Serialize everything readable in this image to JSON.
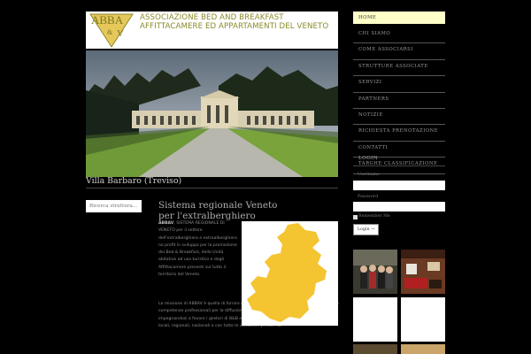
{
  "header": {
    "logo_text": "ABBA",
    "org_line1": "ASSOCIAZIONE BED AND BREAKFAST",
    "org_line2": "AFFITTACAMERE ED APPARTAMENTI DEL VENETO"
  },
  "hero": {
    "caption": "Villa Barbaro (Treviso)"
  },
  "search": {
    "placeholder": "Ricerca struttura..."
  },
  "article": {
    "title": "Sistema regionale Veneto per l'extralberghiero",
    "lead_bold": "ABBAV",
    "lead_rest": ", SISTEMA REGIONALE DI VENETO per il settore dell'extralberghiero e extraalberghiero no profit in sviluppo per la promozione dei Bed & Breakfast, delle Unità abitative ad uso turistico e degli Affittacamere presenti sul tutto il territorio del Veneto.",
    "para2": "La missione di ABBAV è quella di fornire consulenza e servizi di alta qualità, assistenza e competenze professionali per la diffusione dei servizi tipologie. ABBAV mette impegnandosi a favore i gestori di B&B e Affittacamere nei rapporti con gli enti pubblici locali, regionali, nazionali e con tutte le istituzioni private sul"
  },
  "nav": {
    "items": [
      {
        "label": "HOME",
        "active": true
      },
      {
        "label": "CHI SIAMO",
        "active": false
      },
      {
        "label": "COME ASSOCIARSI",
        "active": false
      },
      {
        "label": "STRUTTURE ASSOCIATE",
        "active": false
      },
      {
        "label": "SERVIZI",
        "active": false
      },
      {
        "label": "PARTNERS",
        "active": false
      },
      {
        "label": "NOTIZIE",
        "active": false
      },
      {
        "label": "RICHIESTA PRENOTAZIONE",
        "active": false
      },
      {
        "label": "CONTATTI",
        "active": false
      },
      {
        "label": "TARGHE CLASSIFICAZIONE",
        "active": false
      }
    ]
  },
  "login": {
    "title": "LOGIN",
    "username_label": "Username",
    "password_label": "Password",
    "remember_label": "Remember Me",
    "button_label": "Login →"
  },
  "colors": {
    "accent_yellow": "#ffffc8",
    "map_yellow": "#f5c431",
    "logo_olive": "#8a8a2a",
    "background": "#000000"
  }
}
